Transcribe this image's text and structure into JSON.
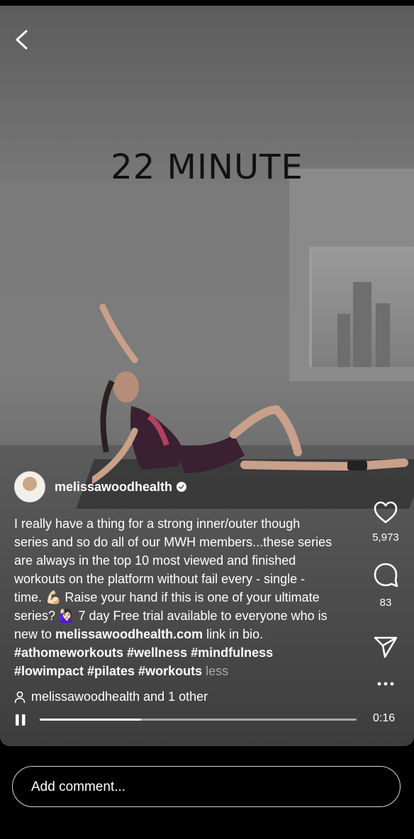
{
  "video": {
    "overlay_text": "22 MINUTE",
    "progress_fraction": 0.32,
    "time": "0:16"
  },
  "post": {
    "username": "melissawoodhealth",
    "caption_lines": [
      "I really have a thing for a strong inner/outer though",
      "series and so do all of our MWH members...these series",
      "are always in the top 10 most viewed and finished",
      "workouts on the platform without fail every - single -",
      "time. 💪🏻 Raise your hand if this is one of your ultimate",
      "series? 🙋🏻‍♀️ 7 day Free trial available to everyone who is"
    ],
    "caption_line7_prefix": "new to ",
    "caption_link": "melissawoodhealth.com",
    "caption_line7_suffix": " link in bio.",
    "hashtags_line1": "#athomeworkouts #wellness #mindfulness",
    "hashtags_line2": "#lowimpact #pilates #workouts",
    "less_label": "less",
    "collab_text": "melissawoodhealth and 1 other"
  },
  "actions": {
    "likes": "5,973",
    "comments": "83"
  },
  "comment_box": {
    "placeholder": "Add comment..."
  }
}
